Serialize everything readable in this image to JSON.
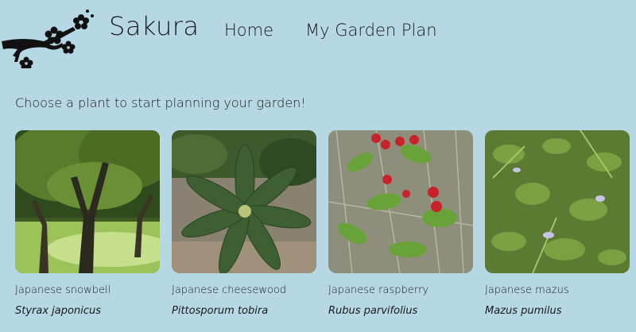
{
  "header": {
    "brand": "Sakura",
    "nav": [
      {
        "label": "Home"
      },
      {
        "label": "My Garden Plan"
      }
    ]
  },
  "intro": "Choose a plant to start planning your garden!",
  "plants": [
    {
      "common": "Japanese snowbell",
      "scientific": "Styrax japonicus"
    },
    {
      "common": "Japanese cheesewood",
      "scientific": "Pittosporum tobira"
    },
    {
      "common": "Japanese raspberry",
      "scientific": "Rubus parvifolius"
    },
    {
      "common": "Japanese mazus",
      "scientific": "Mazus pumilus"
    }
  ],
  "colors": {
    "background": "#b6d8e4",
    "text": "#1a1a1a"
  },
  "icons": {
    "logo": "cherry-blossom-branch-icon"
  }
}
